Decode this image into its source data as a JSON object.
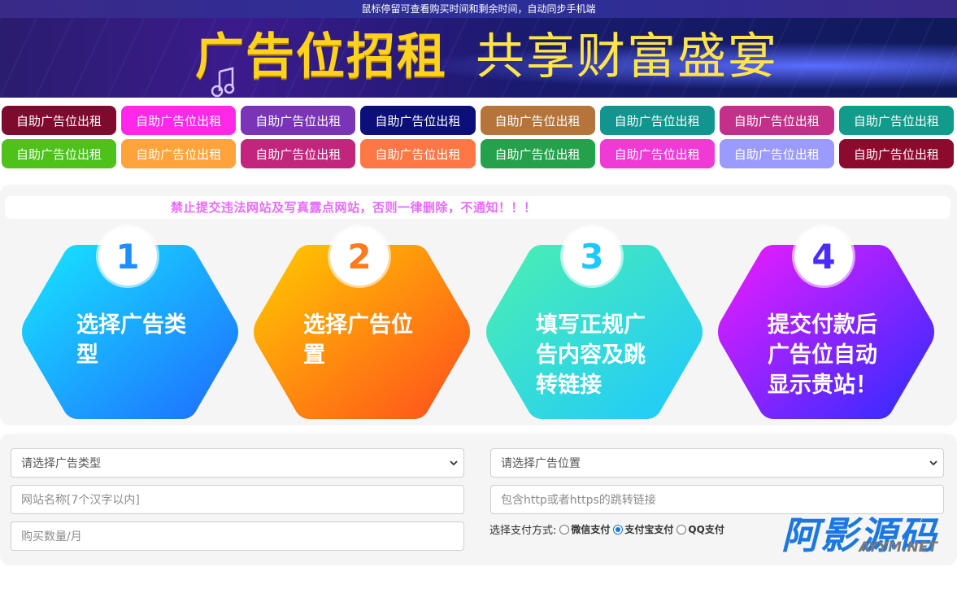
{
  "topbar": {
    "text": "鼠标停留可查看购买时间和剩余时间，自动同步手机端"
  },
  "banner": {
    "left_text": "广告位招租",
    "right_text": "共享财富盛宴"
  },
  "ad_slots": {
    "label": "自助广告位出租",
    "row1_colors": [
      "#7e0a2e",
      "#ff27e9",
      "#7a34b7",
      "#0c0f7a",
      "#b5743a",
      "#12958f",
      "#c42f89",
      "#119b8a"
    ],
    "row2_colors": [
      "#4ec21b",
      "#ffa33a",
      "#c2257c",
      "#ff7744",
      "#26a14b",
      "#f03ad6",
      "#9b9bff",
      "#8c0a2c"
    ]
  },
  "notice": "禁止提交违法网站及写真露点网站，否则一律删除，不通知！！！",
  "steps": [
    {
      "num": "1",
      "line1": "选择广告类",
      "line2": "型",
      "line3": "",
      "grad": [
        "#17e7ff",
        "#1e6bff"
      ],
      "numcolor": "#1e8fff"
    },
    {
      "num": "2",
      "line1": "选择广告位",
      "line2": "置",
      "line3": "",
      "grad": [
        "#ffcc00",
        "#ff4d1c"
      ],
      "numcolor": "#ff7a1c"
    },
    {
      "num": "3",
      "line1": "填写正规广",
      "line2": "告内容及跳",
      "line3": "转链接",
      "grad": [
        "#4cf0b0",
        "#1ec8ff"
      ],
      "numcolor": "#1ec8ff"
    },
    {
      "num": "4",
      "line1": "提交付款后",
      "line2": "广告位自动",
      "line3": "显示贵站！",
      "grad": [
        "#f01cff",
        "#2a2cff"
      ],
      "numcolor": "#4a2cff"
    }
  ],
  "form": {
    "ad_type_select": "请选择广告类型",
    "ad_position_select": "请选择广告位置",
    "site_name_placeholder": "网站名称[7个汉字以内]",
    "link_placeholder": "包含http或者https的跳转链接",
    "quantity_placeholder": "购买数量/月",
    "pay_label": "选择支付方式:",
    "pay_options": [
      "微信支付",
      "支付宝支付",
      "QQ支付"
    ],
    "pay_selected": "支付宝支付"
  },
  "watermark": {
    "cn": "阿影源码",
    "en": "AYYM.NET"
  }
}
